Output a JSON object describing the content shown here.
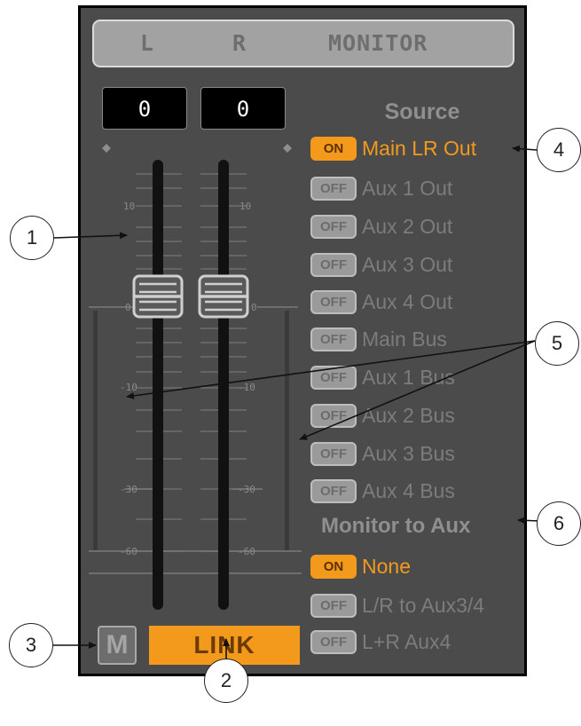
{
  "header": {
    "left": "L",
    "right": "R",
    "title": "MONITOR"
  },
  "levels": {
    "left_value": "0",
    "right_value": "0"
  },
  "scale": {
    "ticks_left": [
      "10",
      "0",
      "-10",
      "-30",
      "-60"
    ],
    "ticks_right": [
      "10",
      "0",
      "-10",
      "-30",
      "-60"
    ]
  },
  "source": {
    "title": "Source",
    "items": [
      {
        "state": "ON",
        "label": "Main LR Out",
        "active": true
      },
      {
        "state": "OFF",
        "label": "Aux 1 Out",
        "active": false
      },
      {
        "state": "OFF",
        "label": "Aux 2 Out",
        "active": false
      },
      {
        "state": "OFF",
        "label": "Aux 3 Out",
        "active": false
      },
      {
        "state": "OFF",
        "label": "Aux 4 Out",
        "active": false
      },
      {
        "state": "OFF",
        "label": "Main Bus",
        "active": false
      },
      {
        "state": "OFF",
        "label": "Aux 1 Bus",
        "active": false
      },
      {
        "state": "OFF",
        "label": "Aux 2 Bus",
        "active": false
      },
      {
        "state": "OFF",
        "label": "Aux 3 Bus",
        "active": false
      },
      {
        "state": "OFF",
        "label": "Aux 4 Bus",
        "active": false
      }
    ]
  },
  "monitor_to_aux": {
    "title": "Monitor to Aux",
    "items": [
      {
        "state": "ON",
        "label": "None",
        "active": true
      },
      {
        "state": "OFF",
        "label": "L/R to Aux3/4",
        "active": false
      },
      {
        "state": "OFF",
        "label": "L+R Aux4",
        "active": false
      }
    ]
  },
  "buttons": {
    "mute": "M",
    "link": "LINK"
  },
  "callouts": [
    "1",
    "2",
    "3",
    "4",
    "5",
    "6"
  ],
  "colors": {
    "accent": "#f39a1c",
    "panel": "#4b4b4b"
  }
}
